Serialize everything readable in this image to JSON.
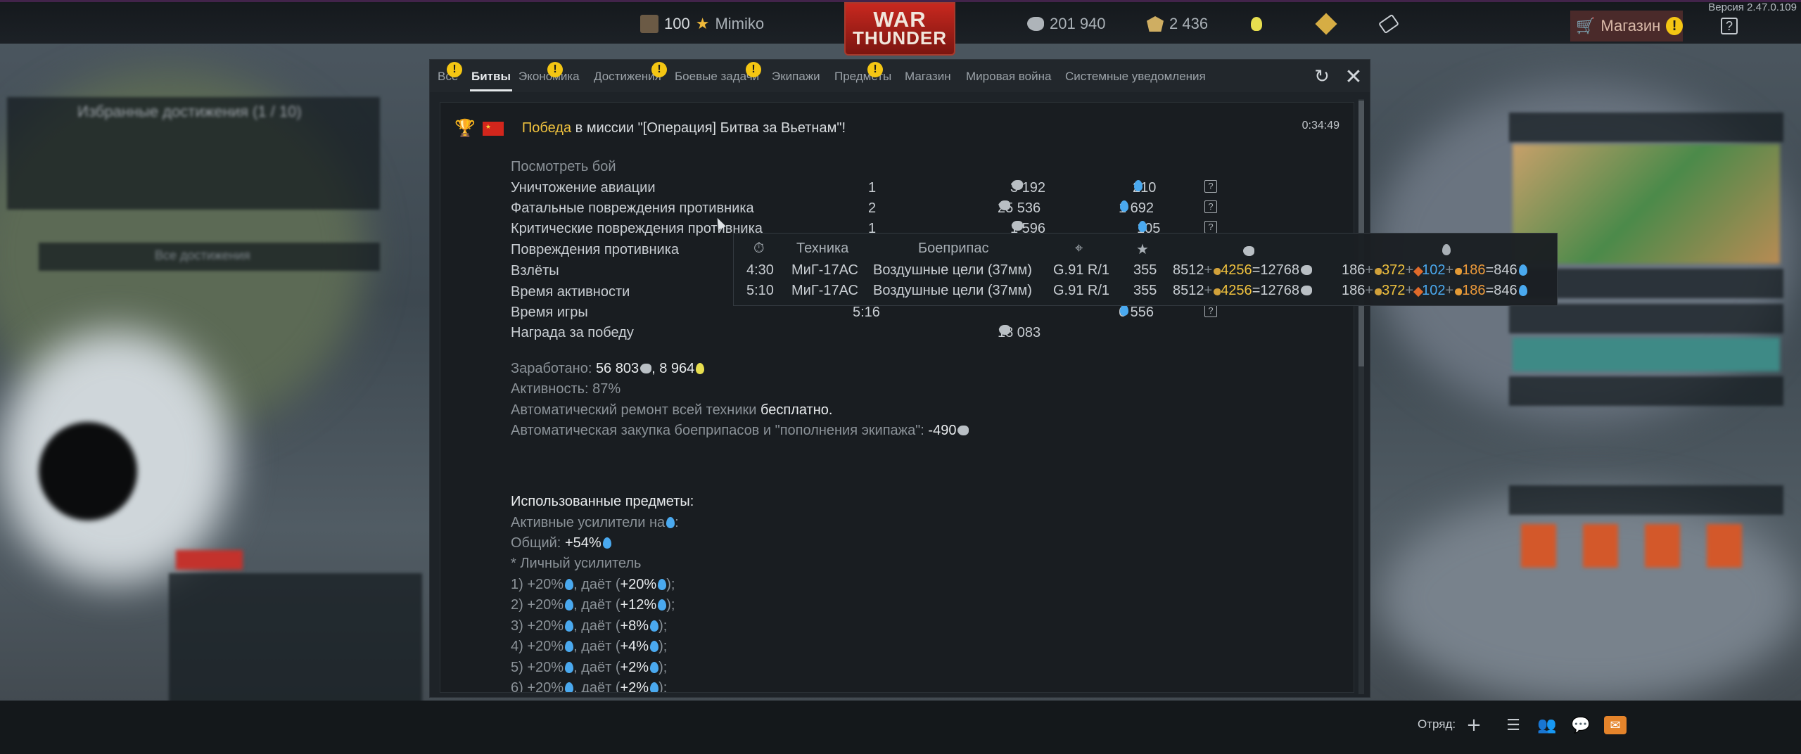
{
  "topbar": {
    "rank": "100",
    "player": "Mimiko",
    "logo_line1": "WAR",
    "logo_line2": "THUNDER",
    "silver_lions": "201 940",
    "golden_eagles": "2 436",
    "shop_label": "Магазин",
    "shop_warn": "!",
    "version": "Версия 2.47.0.109",
    "help": "?"
  },
  "tabs": [
    {
      "label": "Все",
      "warn": "!"
    },
    {
      "label": "Битвы",
      "active": true
    },
    {
      "label": "Экономика",
      "warn": "!"
    },
    {
      "label": "Достижения",
      "warn": "!"
    },
    {
      "label": "Боевые задачи",
      "warn": "!"
    },
    {
      "label": "Экипажи"
    },
    {
      "label": "Предметы",
      "warn": "!"
    },
    {
      "label": "Магазин"
    },
    {
      "label": "Мировая война"
    },
    {
      "label": "Системные уведомления"
    }
  ],
  "message": {
    "victory_word": "Победа",
    "title_rest": "в миссии \"[Операция] Битва за Вьетнам\"!",
    "time": "0:34:49",
    "view_battle": "Посмотреть бой",
    "rows": [
      {
        "label": "Уничтожение авиации",
        "count": "1",
        "sl": "3 192",
        "rp": "210",
        "help": "?"
      },
      {
        "label": "Фатальные повреждения противника",
        "count": "2",
        "sl": "25 536",
        "rp": "1 692",
        "help": "?"
      },
      {
        "label": "Критические повреждения противника",
        "count": "1",
        "sl": "1 596",
        "rp": "105",
        "help": "?"
      },
      {
        "label": "Повреждения противника",
        "count": "",
        "sl": "",
        "rp": "",
        "help": ""
      },
      {
        "label": "Взлёты",
        "count": "",
        "sl": "",
        "rp": "",
        "help": ""
      },
      {
        "label": "Время активности",
        "count": "",
        "sl": "",
        "rp": "",
        "help": ""
      },
      {
        "label": "Время игры",
        "count": "5:16",
        "sl": "",
        "rp": "6 556",
        "help": "?"
      },
      {
        "label": "Награда за победу",
        "count": "",
        "sl": "18 083",
        "rp": "",
        "help": ""
      }
    ],
    "earned_label": "Заработано:",
    "earned_sl": "56 803",
    "earned_rp": "8 964",
    "activity": "Активность: 87%",
    "repair_label": "Автоматический ремонт всей техники",
    "repair_value": "бесплатно.",
    "purchase_label": "Автоматическая закупка боеприпасов и \"пополнения экипажа\":",
    "purchase_value": "-490",
    "items_title": "Использованные предметы:",
    "boosters_label": "Активные усилители на",
    "general_label": "Общий:",
    "general_value": "+54%",
    "personal_label": "* Личный усилитель",
    "boosters": [
      {
        "n": "1)",
        "pct": "+20%",
        "gives": "+20%"
      },
      {
        "n": "2)",
        "pct": "+20%",
        "gives": "+12%"
      },
      {
        "n": "3)",
        "pct": "+20%",
        "gives": "+8%"
      },
      {
        "n": "4)",
        "pct": "+20%",
        "gives": "+4%"
      },
      {
        "n": "5)",
        "pct": "+20%",
        "gives": "+2%"
      },
      {
        "n": "6)",
        "pct": "+20%",
        "gives": "+2%"
      }
    ],
    "gives_word": "даёт"
  },
  "tooltip": {
    "headers": {
      "vehicle": "Техника",
      "ammo": "Боеприпас"
    },
    "rows": [
      {
        "time": "4:30",
        "vehicle": "МиГ-17АС",
        "ammo": "Воздушные цели (37мм)",
        "weapon": "G.91 R/1",
        "score": "355",
        "sl_base": "8512",
        "sl_bonus": "4256",
        "sl_total": "12768",
        "rp_base": "186",
        "rp_b1": "372",
        "rp_b2": "102",
        "rp_b3": "186",
        "rp_total": "846"
      },
      {
        "time": "5:10",
        "vehicle": "МиГ-17АС",
        "ammo": "Воздушные цели (37мм)",
        "weapon": "G.91 R/1",
        "score": "355",
        "sl_base": "8512",
        "sl_bonus": "4256",
        "sl_total": "12768",
        "rp_base": "186",
        "rp_b1": "372",
        "rp_b2": "102",
        "rp_b3": "186",
        "rp_total": "846"
      }
    ]
  },
  "bottombar": {
    "squad": "Отряд:"
  },
  "background": {
    "achievements_title": "Избранные достижения (1 / 10)",
    "achievements_button": "Все достижения"
  },
  "colors": {
    "victory": "#f0c23e",
    "research_points": "#4aa9ef",
    "warning": "#f4c613",
    "accent_red": "#c8281f"
  }
}
